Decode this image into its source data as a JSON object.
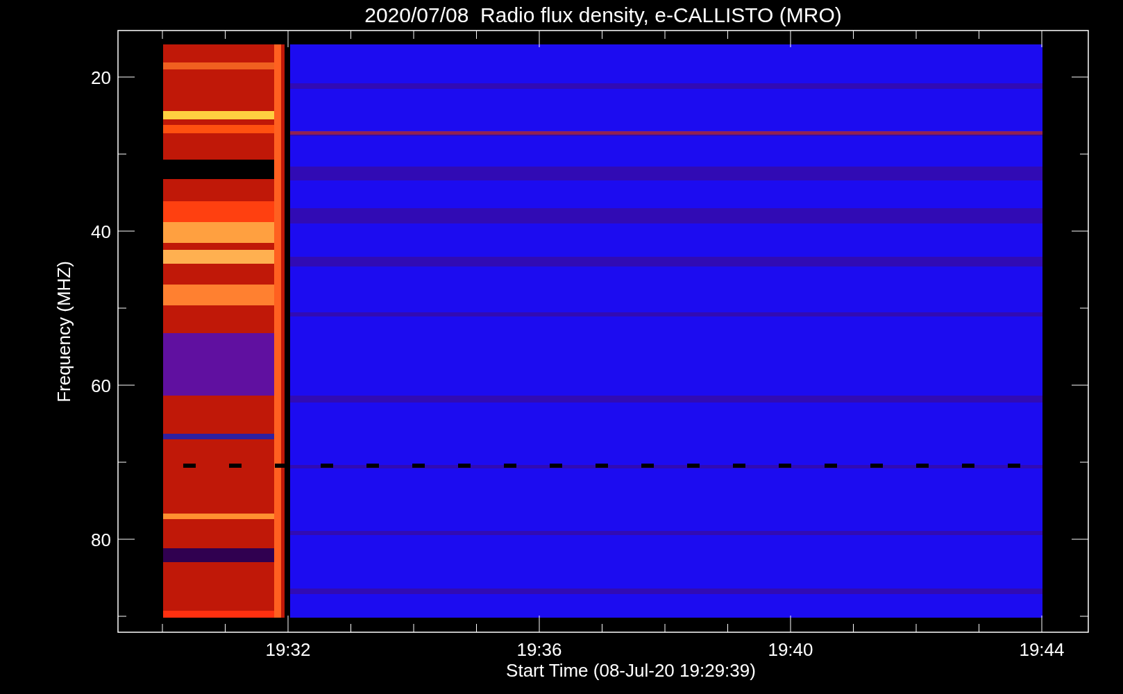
{
  "chart": {
    "title": "2020/07/08  Radio flux density, e-CALLISTO (MRO)",
    "ylabel": "Frequency (MHZ)",
    "yticks": [
      "20",
      "40",
      "60",
      "80"
    ],
    "xticks": [
      "19:32",
      "19:36",
      "19:40",
      "19:44"
    ],
    "xlabel": "Start Time (08-Jul-20 19:29:39)"
  }
}
